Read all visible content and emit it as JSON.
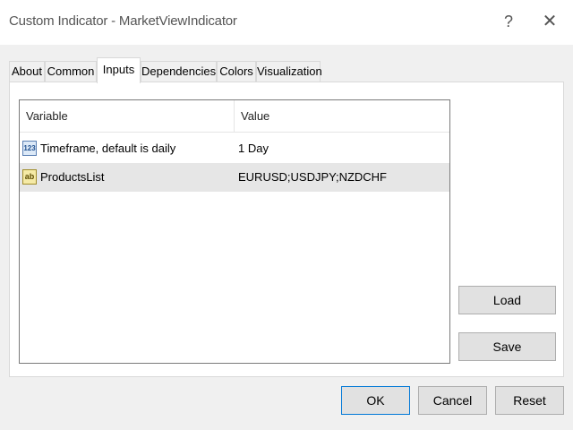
{
  "window": {
    "title": "Custom Indicator - MarketViewIndicator",
    "help_glyph": "?",
    "close_glyph": "✕"
  },
  "tabs": [
    {
      "label": "About"
    },
    {
      "label": "Common"
    },
    {
      "label": "Inputs"
    },
    {
      "label": "Dependencies"
    },
    {
      "label": "Colors"
    },
    {
      "label": "Visualization"
    }
  ],
  "active_tab": "Inputs",
  "grid": {
    "columns": [
      "Variable",
      "Value"
    ],
    "rows": [
      {
        "icon_text": "123",
        "icon": "number-icon",
        "variable": "Timeframe, default is daily",
        "value": "1 Day",
        "selected": false
      },
      {
        "icon_text": "ab",
        "icon": "string-icon",
        "variable": "ProductsList",
        "value": "EURUSD;USDJPY;NZDCHF",
        "selected": true
      }
    ]
  },
  "side_buttons": {
    "load": "Load",
    "save": "Save"
  },
  "footer_buttons": {
    "ok": "OK",
    "cancel": "Cancel",
    "reset": "Reset"
  }
}
